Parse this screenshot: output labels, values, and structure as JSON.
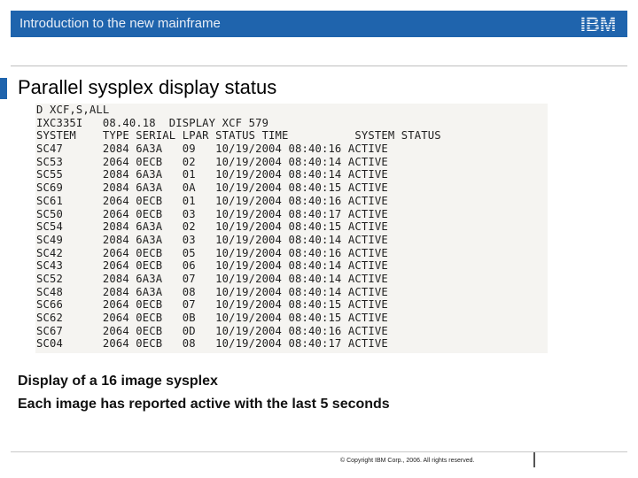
{
  "header": {
    "title": "Introduction to the new mainframe",
    "logo_text": "IBM",
    "bar_color": "#1f64ad"
  },
  "slide": {
    "title": "Parallel sysplex display status"
  },
  "console": {
    "lines": [
      "D XCF,S,ALL",
      "IXC335I   08.40.18  DISPLAY XCF 579",
      "SYSTEM    TYPE SERIAL LPAR STATUS TIME          SYSTEM STATUS",
      "SC47      2084 6A3A   09   10/19/2004 08:40:16 ACTIVE",
      "SC53      2064 0ECB   02   10/19/2004 08:40:14 ACTIVE",
      "SC55      2084 6A3A   01   10/19/2004 08:40:14 ACTIVE",
      "SC69      2084 6A3A   0A   10/19/2004 08:40:15 ACTIVE",
      "SC61      2064 0ECB   01   10/19/2004 08:40:16 ACTIVE",
      "SC50      2064 0ECB   03   10/19/2004 08:40:17 ACTIVE",
      "SC54      2084 6A3A   02   10/19/2004 08:40:15 ACTIVE",
      "SC49      2084 6A3A   03   10/19/2004 08:40:14 ACTIVE",
      "SC42      2064 0ECB   05   10/19/2004 08:40:16 ACTIVE",
      "SC43      2064 0ECB   06   10/19/2004 08:40:14 ACTIVE",
      "SC52      2084 6A3A   07   10/19/2004 08:40:14 ACTIVE",
      "SC48      2084 6A3A   08   10/19/2004 08:40:14 ACTIVE",
      "SC66      2064 0ECB   07   10/19/2004 08:40:15 ACTIVE",
      "SC62      2064 0ECB   0B   10/19/2004 08:40:15 ACTIVE",
      "SC67      2064 0ECB   0D   10/19/2004 08:40:16 ACTIVE",
      "SC04      2064 0ECB   08   10/19/2004 08:40:17 ACTIVE"
    ]
  },
  "captions": [
    "Display of a 16 image sysplex",
    "Each image has reported active with the last 5 seconds"
  ],
  "footer": {
    "copyright": "© Copyright IBM Corp., 2006. All rights reserved."
  }
}
